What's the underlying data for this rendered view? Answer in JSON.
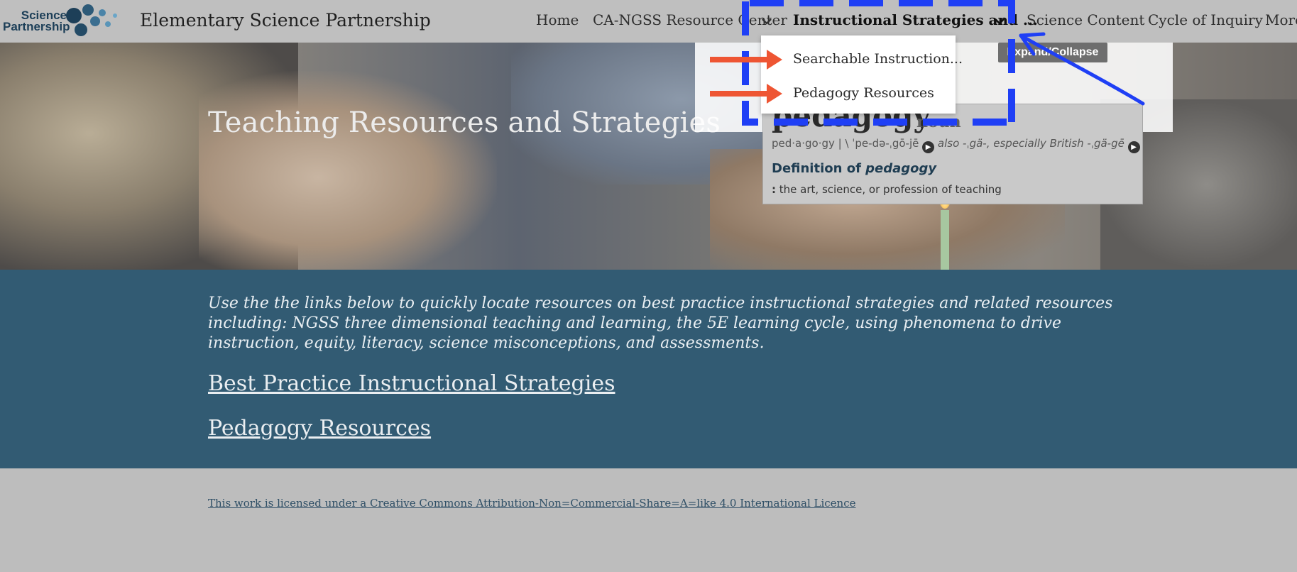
{
  "header": {
    "logo_line1": "Science",
    "logo_line2": "Partnership",
    "site_title": "Elementary Science Partnership",
    "nav": [
      {
        "label": "Home"
      },
      {
        "label": "CA-NGSS Resource Center"
      },
      {
        "label": "Instructional Strategies and ..."
      },
      {
        "label": "Science Content"
      },
      {
        "label": "Cycle of Inquiry"
      },
      {
        "label": "More"
      }
    ]
  },
  "dropdown": {
    "items": [
      {
        "label": "Searchable Instruction..."
      },
      {
        "label": "Pedagogy Resources"
      }
    ]
  },
  "tooltip": {
    "text": "Expand/Collapse"
  },
  "definition": {
    "word": "pedagogy",
    "pos": "noun",
    "pronunciation_a": "ped·a·go·gy  |  \\ ˈpe-də-ˌgō-jē",
    "pronunciation_b": "also -ˌgä-,",
    "pronunciation_c": "especially British -ˌgä-gē",
    "pronunciation_d": "\\",
    "heading_prefix": "Definition of ",
    "heading_word": "pedagogy",
    "sense_marker": ":",
    "sense_text": "the art, science, or profession of teaching"
  },
  "hero": {
    "title": "Teaching Resources and Strategies"
  },
  "main": {
    "intro": "Use the the links below to quickly locate resources on best practice instructional strategies and related resources including: NGSS three dimensional teaching and learning, the 5E learning cycle, using phenomena to drive instruction, equity, literacy, science misconceptions, and assessments.",
    "links": [
      {
        "label": "Best Practice Instructional Strategies"
      },
      {
        "label": "Pedagogy Resources"
      }
    ]
  },
  "footer": {
    "license": "This work is licensed under a Creative Commons Attribution-Non=Commercial-Share=A=like 4.0 International Licence"
  },
  "colors": {
    "band": "#325b73",
    "annotation_blue": "#1f3ff5",
    "annotation_red": "#ee5533"
  }
}
